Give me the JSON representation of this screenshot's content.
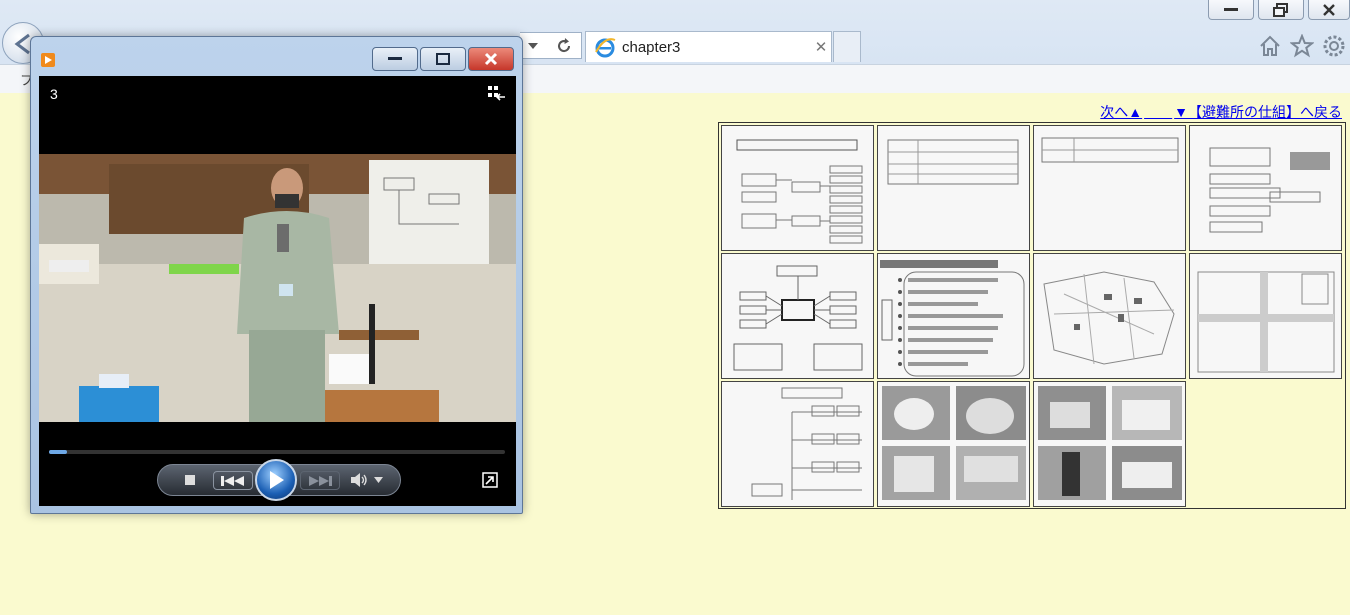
{
  "browser": {
    "tab_title": "chapter3",
    "tab_close": "✕",
    "menu_fragment": "フ"
  },
  "player": {
    "track_number": "3",
    "progress_fraction": 0.04,
    "colors": {
      "accent": "#6ea8e6",
      "close": "#c6372a"
    }
  },
  "page": {
    "nav": {
      "next_label": "次へ▲",
      "blank_spacer": "＿＿",
      "back_label": "▼【避難所の仕組】へ戻る"
    },
    "thumbnails": [
      {
        "name": "slide-1"
      },
      {
        "name": "slide-2"
      },
      {
        "name": "slide-3"
      },
      {
        "name": "slide-4"
      },
      {
        "name": "slide-5"
      },
      {
        "name": "slide-6"
      },
      {
        "name": "slide-7"
      },
      {
        "name": "slide-8"
      },
      {
        "name": "slide-9"
      },
      {
        "name": "slide-10"
      },
      {
        "name": "slide-11"
      }
    ],
    "background_color": "#fafacf"
  }
}
